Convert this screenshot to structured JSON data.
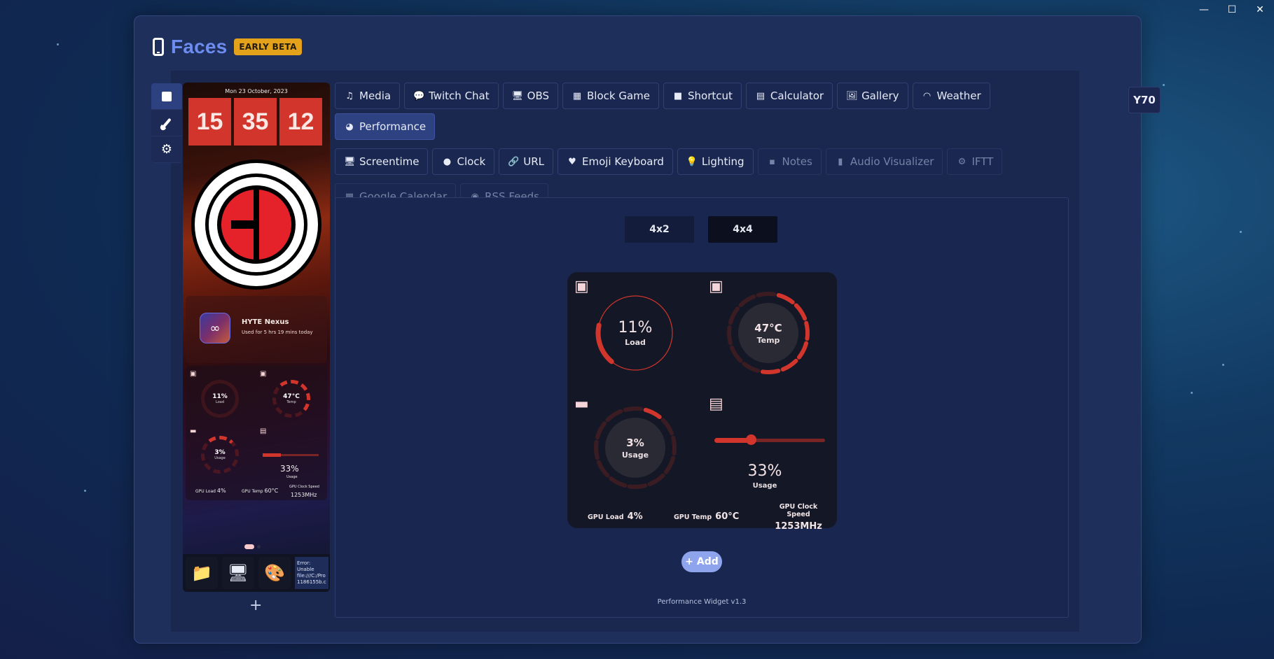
{
  "window_controls": {
    "minimize": "—",
    "maximize": "☐",
    "close": "✕"
  },
  "header": {
    "title": "Faces",
    "badge": "EARLY BETA"
  },
  "device_button": "Y70",
  "side_tabs": [
    {
      "name": "faces",
      "icon": "square-icon"
    },
    {
      "name": "theme",
      "icon": "brush-icon"
    },
    {
      "name": "settings",
      "icon": "gear-icon"
    }
  ],
  "preview": {
    "date": "Mon 23 October, 2023",
    "clock": {
      "h": "15",
      "m": "35",
      "s": "12"
    },
    "nexus": {
      "title": "HYTE Nexus",
      "subtitle": "Used for 5 hrs 19 mins today",
      "logo_text": "∞"
    },
    "mini_perf": {
      "cpu_load": "11%",
      "cpu_load_label": "Load",
      "cpu_temp": "47°C",
      "cpu_temp_label": "Temp",
      "disk_usage": "3%",
      "disk_label": "Usage",
      "ram_usage": "33%",
      "ram_label": "Usage",
      "gpu_load_label": "GPU Load",
      "gpu_load": "4%",
      "gpu_temp_label": "GPU Temp",
      "gpu_temp": "60°C",
      "gpu_clock_label": "GPU Clock Speed",
      "gpu_clock": "1253MHz"
    },
    "dock": {
      "apps": [
        "📁",
        "🖥",
        "🎨"
      ],
      "error_text": "Error: Unable file:///C:/Pro 1186155b.c"
    },
    "add_face": "+"
  },
  "tabs": [
    {
      "label": "Media",
      "icon": "♫",
      "state": "normal"
    },
    {
      "label": "Twitch Chat",
      "icon": "💬",
      "state": "normal"
    },
    {
      "label": "OBS",
      "icon": "🖥",
      "state": "normal"
    },
    {
      "label": "Block Game",
      "icon": "▦",
      "state": "normal"
    },
    {
      "label": "Shortcut",
      "icon": "■",
      "state": "normal"
    },
    {
      "label": "Calculator",
      "icon": "▤",
      "state": "normal"
    },
    {
      "label": "Gallery",
      "icon": "🖼",
      "state": "normal"
    },
    {
      "label": "Weather",
      "icon": "◠",
      "state": "normal"
    },
    {
      "label": "Performance",
      "icon": "◕",
      "state": "active"
    },
    {
      "label": "Screentime",
      "icon": "🖥",
      "state": "normal"
    },
    {
      "label": "Clock",
      "icon": "●",
      "state": "normal"
    },
    {
      "label": "URL",
      "icon": "🔗",
      "state": "normal"
    },
    {
      "label": "Emoji Keyboard",
      "icon": "♥",
      "state": "normal"
    },
    {
      "label": "Lighting",
      "icon": "💡",
      "state": "normal"
    },
    {
      "label": "Notes",
      "icon": "▪",
      "state": "disabled"
    },
    {
      "label": "Audio Visualizer",
      "icon": "▮",
      "state": "disabled"
    },
    {
      "label": "IFTT",
      "icon": "⚙",
      "state": "disabled"
    },
    {
      "label": "Google Calendar",
      "icon": "▦",
      "state": "disabled"
    },
    {
      "label": "RSS Feeds",
      "icon": "◉",
      "state": "disabled"
    }
  ],
  "size_options": [
    {
      "label": "4x2",
      "active": false
    },
    {
      "label": "4x4",
      "active": true
    }
  ],
  "widget": {
    "cpu_load": {
      "value": "11%",
      "label": "Load",
      "fraction": 0.11
    },
    "cpu_temp": {
      "value": "47°C",
      "label": "Temp",
      "fraction": 0.47
    },
    "disk": {
      "value": "3%",
      "label": "Usage",
      "fraction": 0.03
    },
    "ram": {
      "value": "33%",
      "label": "Usage",
      "fraction": 0.33
    },
    "gpu_load": {
      "label": "GPU Load",
      "value": "4%"
    },
    "gpu_temp": {
      "label": "GPU Temp",
      "value": "60°C"
    },
    "gpu_clock": {
      "label": "GPU Clock Speed",
      "value": "1253MHz"
    },
    "colors": {
      "accent": "#d1352b",
      "track": "#3a1c22",
      "inner": "#2a2a35"
    }
  },
  "add_button": "+ Add",
  "version": "Performance Widget v1.3"
}
